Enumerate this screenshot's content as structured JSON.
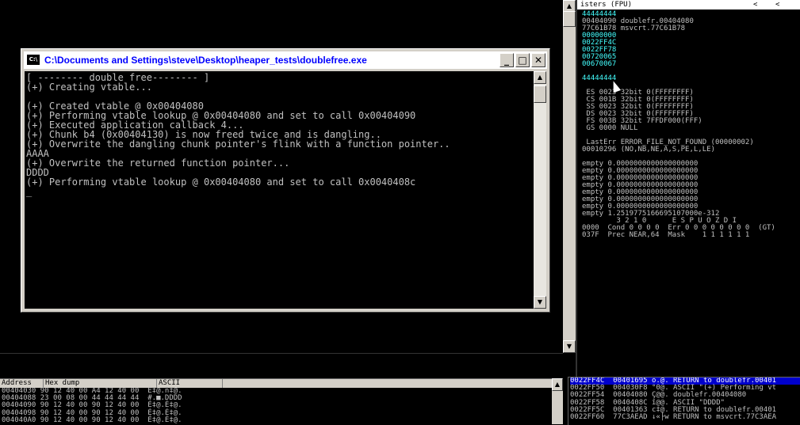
{
  "console": {
    "title": "C:\\Documents and Settings\\steve\\Desktop\\heaper_tests\\doublefree.exe",
    "icon": "C:\\",
    "lines": [
      "[ -------- double free-------- ]",
      "(+) Creating vtable...",
      "",
      "(+) Created vtable @ 0x00404080",
      "(+) Performing vtable lookup @ 0x00404080 and set to call 0x00404090",
      "(+) Executed application callback 4...",
      "(+) Chunk b4 (0x00404130) is now freed twice and is dangling..",
      "(+) Overwrite the dangling chunk pointer's flink with a function pointer..",
      "AAAA",
      "(+) Overwrite the returned function pointer...",
      "DDDD",
      "(+) Performing vtable lookup @ 0x00404080 and set to call 0x0040408c",
      "_"
    ],
    "minimize_label": "_",
    "maximize_label": "□",
    "close_label": "✕"
  },
  "registers": {
    "header": "isters (FPU)",
    "nav_left": "<",
    "nav_right": "<",
    "lines": [
      {
        "text": "44444444",
        "cls": "hl"
      },
      {
        "text": "00404090 doublefr.00404080",
        "cls": ""
      },
      {
        "text": "77C61B78 msvcrt.77C61B78",
        "cls": ""
      },
      {
        "text": "00000000",
        "cls": "hl"
      },
      {
        "text": "0022FF4C",
        "cls": "hl"
      },
      {
        "text": "0022FF78",
        "cls": "hl"
      },
      {
        "text": "00720065",
        "cls": "hl"
      },
      {
        "text": "00670067",
        "cls": "hl"
      },
      {
        "text": "",
        "cls": ""
      },
      {
        "text": "44444444",
        "cls": "hl"
      },
      {
        "text": "",
        "cls": ""
      },
      {
        "text": " ES 0023 32bit 0(FFFFFFFF)",
        "cls": ""
      },
      {
        "text": " CS 001B 32bit 0(FFFFFFFF)",
        "cls": ""
      },
      {
        "text": " SS 0023 32bit 0(FFFFFFFF)",
        "cls": ""
      },
      {
        "text": " DS 0023 32bit 0(FFFFFFFF)",
        "cls": ""
      },
      {
        "text": " FS 003B 32bit 7FFDF000(FFF)",
        "cls": ""
      },
      {
        "text": " GS 0000 NULL",
        "cls": ""
      },
      {
        "text": "",
        "cls": ""
      },
      {
        "text": " LastErr ERROR_FILE_NOT_FOUND (00000002)",
        "cls": ""
      },
      {
        "text": "00010296 (NO,NB,NE,A,S,PE,L,LE)",
        "cls": ""
      },
      {
        "text": "",
        "cls": ""
      },
      {
        "text": "empty 0.0000000000000000000",
        "cls": ""
      },
      {
        "text": "empty 0.0000000000000000000",
        "cls": ""
      },
      {
        "text": "empty 0.0000000000000000000",
        "cls": ""
      },
      {
        "text": "empty 0.0000000000000000000",
        "cls": ""
      },
      {
        "text": "empty 0.0000000000000000000",
        "cls": ""
      },
      {
        "text": "empty 0.0000000000000000000",
        "cls": ""
      },
      {
        "text": "empty 0.0000000000000000000",
        "cls": ""
      },
      {
        "text": "empty 1.2519775166695107000e-312",
        "cls": ""
      },
      {
        "text": "        3 2 1 0      E S P U O Z D I",
        "cls": ""
      },
      {
        "text": "0000  Cond 0 0 0 0  Err 0 0 0 0 0 0 0 0  (GT)",
        "cls": ""
      },
      {
        "text": "037F  Prec NEAR,64  Mask    1 1 1 1 1 1",
        "cls": ""
      }
    ]
  },
  "dump": {
    "col_address": "Address",
    "col_hex": "Hex dump",
    "col_ascii": "ASCII",
    "rows": [
      "00404030 90 12 40 00 A4 12 40 00  É‡@.ñ‡@.",
      "00404088 23 00 08 00 44 44 44 44  #.■.DDDD",
      "00404090 90 12 40 00 90 12 40 00  É‡@.É‡@.",
      "00404098 90 12 40 00 90 12 40 00  É‡@.É‡@.",
      "004040A0 90 12 40 00 90 12 40 00  É‡@.É‡@."
    ]
  },
  "stack": {
    "rows": [
      {
        "text": "0022FF4C  00401695 ò.@. RETURN to doublefr.00401",
        "sel": true
      },
      {
        "text": "0022FF50  004030F8 °0@. ASCII \"(+) Performing vt",
        "sel": false
      },
      {
        "text": "0022FF54  00404080 Ç@@. doublefr.00404080",
        "sel": false
      },
      {
        "text": "0022FF58  0040408C î@@. ASCII \"DDDD\"",
        "sel": false
      },
      {
        "text": "0022FF5C  00401363 c‡@. RETURN to doublefr.00401",
        "sel": false
      },
      {
        "text": "0022FF60  77C3AEAD ↓«├w RETURN to msvcrt.77C3AEA",
        "sel": false
      }
    ]
  },
  "scroll": {
    "up": "▲",
    "down": "▼"
  }
}
